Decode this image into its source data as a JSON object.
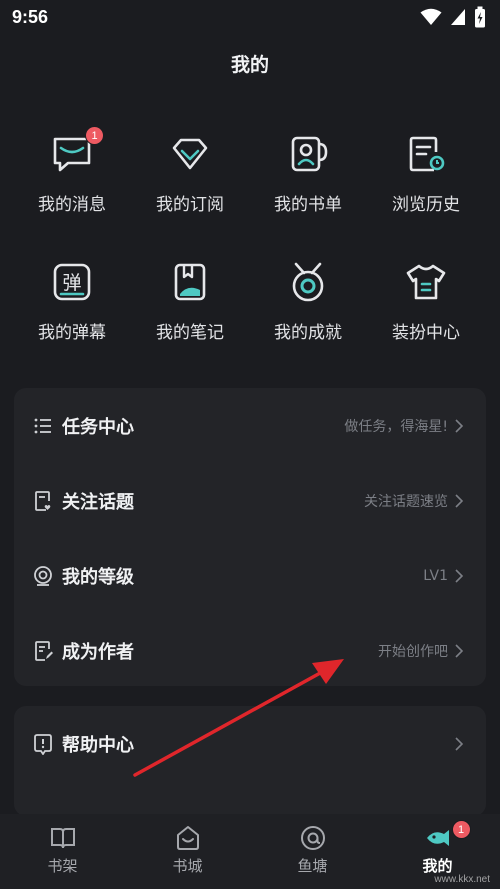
{
  "status": {
    "time": "9:56"
  },
  "page": {
    "title": "我的"
  },
  "grid": [
    {
      "label": "我的消息",
      "icon": "message-icon",
      "badge": "1"
    },
    {
      "label": "我的订阅",
      "icon": "diamond-icon"
    },
    {
      "label": "我的书单",
      "icon": "booklist-icon"
    },
    {
      "label": "浏览历史",
      "icon": "history-icon"
    },
    {
      "label": "我的弹幕",
      "icon": "danmaku-icon",
      "glyph": "弹"
    },
    {
      "label": "我的笔记",
      "icon": "notes-icon"
    },
    {
      "label": "我的成就",
      "icon": "medal-icon"
    },
    {
      "label": "装扮中心",
      "icon": "tshirt-icon"
    }
  ],
  "card1": [
    {
      "title": "任务中心",
      "hint": "做任务，得海星!",
      "icon": "list-icon"
    },
    {
      "title": "关注话题",
      "hint": "关注话题速览",
      "icon": "topic-icon"
    },
    {
      "title": "我的等级",
      "hint": "LV1",
      "icon": "level-icon"
    },
    {
      "title": "成为作者",
      "hint": "开始创作吧",
      "icon": "author-icon"
    }
  ],
  "card2": [
    {
      "title": "帮助中心",
      "icon": "help-icon"
    }
  ],
  "tabs": [
    {
      "label": "书架",
      "icon": "bookshelf-icon"
    },
    {
      "label": "书城",
      "icon": "bookstore-icon"
    },
    {
      "label": "鱼塘",
      "icon": "fishpond-icon"
    },
    {
      "label": "我的",
      "icon": "profile-icon",
      "badge": "1",
      "active": true
    }
  ],
  "watermark": "www.kkx.net",
  "colors": {
    "accent": "#4ec9c3",
    "badge": "#ee5a62",
    "arrow": "#e0262b",
    "background": "#1b1c20",
    "card": "#232428"
  }
}
